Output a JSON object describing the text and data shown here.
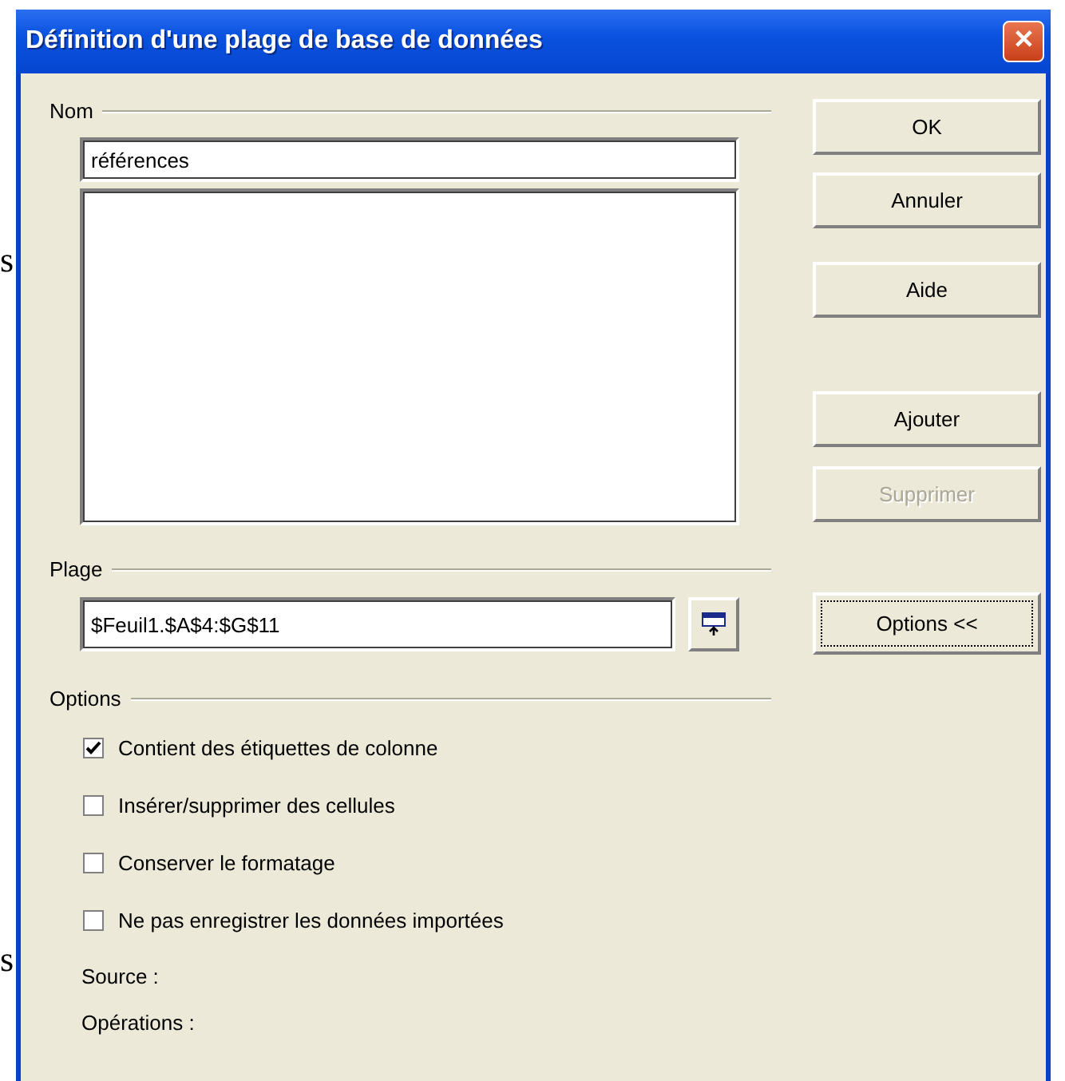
{
  "background": {
    "fragments": [
      "s",
      "s"
    ]
  },
  "window": {
    "title": "Définition d'une plage de base de données",
    "close": "✕"
  },
  "nom": {
    "label": "Nom",
    "value": "références"
  },
  "buttons": [
    {
      "label": "OK",
      "disabled": false,
      "focused": false
    },
    {
      "label": "Annuler",
      "disabled": false,
      "focused": false
    },
    {
      "label": "Aide",
      "disabled": false,
      "focused": false
    },
    {
      "label": "Ajouter",
      "disabled": false,
      "focused": false
    },
    {
      "label": "Supprimer",
      "disabled": true,
      "focused": false
    }
  ],
  "plage": {
    "label": "Plage",
    "value": "$Feuil1.$A$4:$G$11"
  },
  "options_button": {
    "label": "Options <<",
    "focused": true
  },
  "options": {
    "label": "Options",
    "checkboxes": [
      {
        "label": "Contient des étiquettes de colonne",
        "checked": true
      },
      {
        "label": "Insérer/supprimer des cellules",
        "checked": false
      },
      {
        "label": "Conserver le formatage",
        "checked": false
      },
      {
        "label": "Ne pas enregistrer les données importées",
        "checked": false
      }
    ]
  },
  "info": [
    "Source :",
    "Opérations :"
  ]
}
